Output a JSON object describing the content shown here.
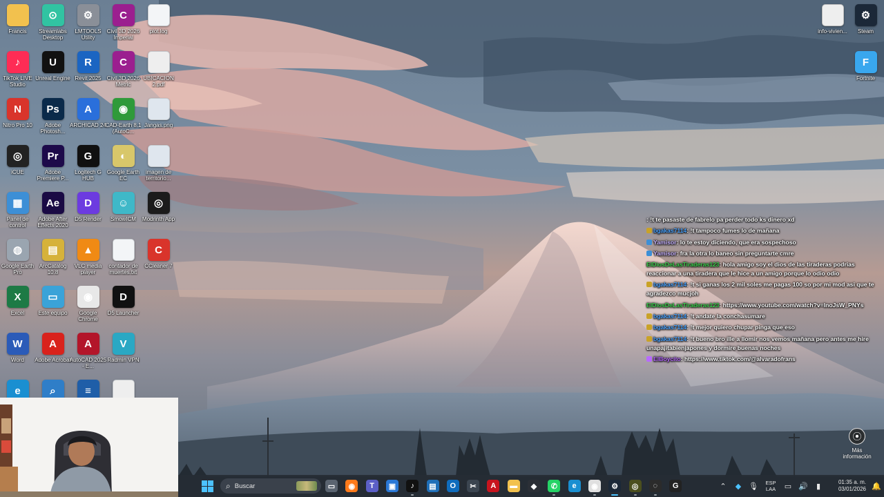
{
  "desktop": {
    "left_icons": [
      {
        "label": "Francis",
        "icon": "folder-icon",
        "color": "#f2c14e",
        "glyph": ""
      },
      {
        "label": "Streamlabs Desktop",
        "icon": "streamlabs-icon",
        "color": "#31c3a2",
        "glyph": "⊙"
      },
      {
        "label": "LMTOOLS Utility",
        "icon": "lmtools-icon",
        "color": "#8a8f98",
        "glyph": "⚙"
      },
      {
        "label": "Civil 3D 2026 Imperial",
        "icon": "civil3d-icon",
        "color": "#9b1f8f",
        "glyph": "C"
      },
      {
        "label": "plot.log",
        "icon": "text-file-icon",
        "color": "#f3f5f7",
        "glyph": ""
      },
      {
        "label": "TikTok LIVE Studio",
        "icon": "tiktok-live-icon",
        "color": "#fe2c55",
        "glyph": "♪"
      },
      {
        "label": "Unreal Engine",
        "icon": "unreal-icon",
        "color": "#111111",
        "glyph": "U"
      },
      {
        "label": "Revit 2025",
        "icon": "revit-icon",
        "color": "#1b65c2",
        "glyph": "R"
      },
      {
        "label": "Civil 3D 2026 Metric",
        "icon": "civil3d-metric-icon",
        "color": "#9b1f8f",
        "glyph": "C"
      },
      {
        "label": "UBICACION 2.pdf",
        "icon": "pdf-file-icon",
        "color": "#eeeeee",
        "glyph": ""
      },
      {
        "label": "Nitro Pro 10",
        "icon": "nitro-icon",
        "color": "#d9342b",
        "glyph": "N"
      },
      {
        "label": "Adobe Photosh...",
        "icon": "photoshop-icon",
        "color": "#0a2a4a",
        "glyph": "Ps"
      },
      {
        "label": "ARCHICAD 24",
        "icon": "archicad-icon",
        "color": "#2a6fdb",
        "glyph": "A"
      },
      {
        "label": "CAD-Earth 8.1 (AutoC...",
        "icon": "cad-earth-icon",
        "color": "#2f9a3a",
        "glyph": "◉"
      },
      {
        "label": "Jangas.png",
        "icon": "image-file-icon",
        "color": "#dfe6ee",
        "glyph": ""
      },
      {
        "label": "iCUE",
        "icon": "icue-icon",
        "color": "#222222",
        "glyph": "◎"
      },
      {
        "label": "Adobe Premiere P...",
        "icon": "premiere-icon",
        "color": "#1d0a4a",
        "glyph": "Pr"
      },
      {
        "label": "Logitech G HUB",
        "icon": "logitech-icon",
        "color": "#101010",
        "glyph": "G"
      },
      {
        "label": "Google Earth EC",
        "icon": "google-earth-ec-icon",
        "color": "#d8c76a",
        "glyph": "◐"
      },
      {
        "label": "imagen de territorio...",
        "icon": "image-file-icon",
        "color": "#dfe6ee",
        "glyph": ""
      },
      {
        "label": "Panel de control",
        "icon": "control-panel-icon",
        "color": "#3d8fd6",
        "glyph": "▦"
      },
      {
        "label": "Adobe After Effects 2020",
        "icon": "after-effects-icon",
        "color": "#1a0a44",
        "glyph": "Ae"
      },
      {
        "label": "D5 Render",
        "icon": "d5-render-icon",
        "color": "#6c3be0",
        "glyph": "D"
      },
      {
        "label": "SmowICM",
        "icon": "smowicm-icon",
        "color": "#3fb8c8",
        "glyph": "☺"
      },
      {
        "label": "Modrinth App",
        "icon": "modrinth-icon",
        "color": "#1b1b1b",
        "glyph": "◎"
      },
      {
        "label": "Google Earth Pro",
        "icon": "google-earth-pro-icon",
        "color": "#9aa5b0",
        "glyph": "◍"
      },
      {
        "label": "ArcCatalog 10.8",
        "icon": "arccatalog-icon",
        "color": "#d6b23a",
        "glyph": "▤"
      },
      {
        "label": "VLC media player",
        "icon": "vlc-icon",
        "color": "#f08a14",
        "glyph": "▲"
      },
      {
        "label": "contador de muertes.txt",
        "icon": "text-file-icon",
        "color": "#f3f5f7",
        "glyph": ""
      },
      {
        "label": "CCleaner 7",
        "icon": "ccleaner-icon",
        "color": "#d9342b",
        "glyph": "C"
      },
      {
        "label": "Excel",
        "icon": "excel-icon",
        "color": "#1d7a45",
        "glyph": "X"
      },
      {
        "label": "Este equipo",
        "icon": "this-pc-icon",
        "color": "#3aa3d8",
        "glyph": "▭"
      },
      {
        "label": "Google Chrome",
        "icon": "chrome-icon",
        "color": "#e8e8e8",
        "glyph": "◉"
      },
      {
        "label": "D5 Launcher",
        "icon": "d5-launcher-icon",
        "color": "#111111",
        "glyph": "D"
      },
      {
        "label": "",
        "icon": "empty-slot",
        "color": "transparent",
        "glyph": ""
      },
      {
        "label": "Word",
        "icon": "word-icon",
        "color": "#2b5bb8",
        "glyph": "W"
      },
      {
        "label": "Adobe Acrobat",
        "icon": "acrobat-icon",
        "color": "#d9221c",
        "glyph": "A"
      },
      {
        "label": "AutoCAD 2025 - E...",
        "icon": "autocad-icon",
        "color": "#b3152a",
        "glyph": "A"
      },
      {
        "label": "Radmin VPN",
        "icon": "radmin-vpn-icon",
        "color": "#2aa8c4",
        "glyph": "V"
      },
      {
        "label": "",
        "icon": "empty-slot",
        "color": "transparent",
        "glyph": ""
      },
      {
        "label": "",
        "icon": "edge-icon",
        "color": "#1a8fd1",
        "glyph": "e"
      },
      {
        "label": "",
        "icon": "search-app-icon",
        "color": "#2f7ec8",
        "glyph": "⌕"
      },
      {
        "label": "",
        "icon": "layers-app-icon",
        "color": "#1f5ea8",
        "glyph": "≡"
      },
      {
        "label": "",
        "icon": "pdf-file-icon",
        "color": "#eeeeee",
        "glyph": ""
      }
    ],
    "right_icons": [
      {
        "label": "info-vivien...",
        "icon": "pdf-file-icon",
        "color": "#eeeeee",
        "glyph": ""
      },
      {
        "label": "Steam",
        "icon": "steam-icon",
        "color": "#1b2838",
        "glyph": "⚙"
      },
      {
        "label": "Fortnite",
        "icon": "fortnite-icon",
        "color": "#39a7ee",
        "glyph": "F"
      }
    ]
  },
  "chat": {
    "messages": [
      {
        "user": "",
        "text": ": !t te pasaste de fabrelo pa perder todo ks dinero xd",
        "color": "#d65cff",
        "badge": ""
      },
      {
        "user": "bgakas7114",
        "text": ": !t tampoco fumes lo de mañana",
        "color": "#4aa3ff",
        "badge": "#c9a227"
      },
      {
        "user": "Yamisor",
        "text": ": lo te estoy diciendo, que era sospechoso",
        "color": "#c7b3ff",
        "badge": "#3d8fd6"
      },
      {
        "user": "Yamisor",
        "text": ": fra la otra lo baneo sin preguntarte cmre",
        "color": "#c7b3ff",
        "badge": "#3d8fd6"
      },
      {
        "user": "ElDiosDeLasTiraderas123",
        "text": ": hola amigo soy el dios de las tiraderas podrias reaccionar a una tiradera que le hice a un amigo porque lo odio odio",
        "color": "#3dd44f",
        "badge": ""
      },
      {
        "user": "bgakas7114",
        "text": ": !t si ganas los 2 mil soles me pagas 100 so por mi mod asi que te agradezco mucjoh",
        "color": "#4aa3ff",
        "badge": "#c9a227"
      },
      {
        "user": "ElDiosDeLasTiraderas123",
        "text": ": https://www.youtube.com/watch?v=lnoJsW_PNYs",
        "color": "#3dd44f",
        "badge": ""
      },
      {
        "user": "bgakas7114",
        "text": ": !t andate la conchasumare",
        "color": "#4aa3ff",
        "badge": "#c9a227"
      },
      {
        "user": "bgakas7114",
        "text": ": !t mejor quiero chupar pinga que eso",
        "color": "#4aa3ff",
        "badge": "#c9a227"
      },
      {
        "user": "bgakas7114",
        "text": ": !t bueno bro ille a llomir nos vemos mañana pero antes me hire unapajitabienjapones y dormire buenas noches",
        "color": "#4aa3ff",
        "badge": "#c9a227"
      },
      {
        "user": "ElBoycito",
        "text": ": https://www.tiktok.com/@alvaradofrans",
        "color": "#b86bff",
        "badge": "#b86bff"
      }
    ]
  },
  "widget": {
    "label": "Más información"
  },
  "taskbar": {
    "search_placeholder": "Buscar",
    "apps": [
      {
        "name": "task-view-icon",
        "color": "#5a6470",
        "glyph": "▭",
        "state": ""
      },
      {
        "name": "firefox-icon",
        "color": "#ff7a1a",
        "glyph": "◉",
        "state": ""
      },
      {
        "name": "teams-icon",
        "color": "#5b5fc7",
        "glyph": "T",
        "state": ""
      },
      {
        "name": "store-icon",
        "color": "#2a78d6",
        "glyph": "▣",
        "state": ""
      },
      {
        "name": "tiktok-icon",
        "color": "#111111",
        "glyph": "♪",
        "state": "running"
      },
      {
        "name": "arcmap-icon",
        "color": "#1f6fb8",
        "glyph": "▤",
        "state": ""
      },
      {
        "name": "outlook-icon",
        "color": "#0f6cbd",
        "glyph": "O",
        "state": ""
      },
      {
        "name": "snipping-icon",
        "color": "#3b4550",
        "glyph": "✂",
        "state": ""
      },
      {
        "name": "acrobat-task-icon",
        "color": "#c8141e",
        "glyph": "A",
        "state": ""
      },
      {
        "name": "file-explorer-icon",
        "color": "#f2c14e",
        "glyph": "▬",
        "state": ""
      },
      {
        "name": "unity-icon",
        "color": "#2b2f36",
        "glyph": "◆",
        "state": ""
      },
      {
        "name": "whatsapp-icon",
        "color": "#25d366",
        "glyph": "✆",
        "state": "running"
      },
      {
        "name": "edge-task-icon",
        "color": "#1a8fd1",
        "glyph": "e",
        "state": ""
      },
      {
        "name": "chrome-task-icon",
        "color": "#e0e0e0",
        "glyph": "◉",
        "state": "running"
      },
      {
        "name": "steam-task-icon",
        "color": "#1b2838",
        "glyph": "⚙",
        "state": "active"
      },
      {
        "name": "gps-icon",
        "color": "#4b4f1e",
        "glyph": "◎",
        "state": "running"
      },
      {
        "name": "obs-icon",
        "color": "#2b2b2b",
        "glyph": "◌",
        "state": "running"
      },
      {
        "name": "ghub-task-icon",
        "color": "#222222",
        "glyph": "G",
        "state": ""
      }
    ],
    "tray": {
      "lang_line1": "ESP",
      "lang_line2": "LAA",
      "time": "01:35 a. m.",
      "date": "03/01/2026"
    }
  }
}
